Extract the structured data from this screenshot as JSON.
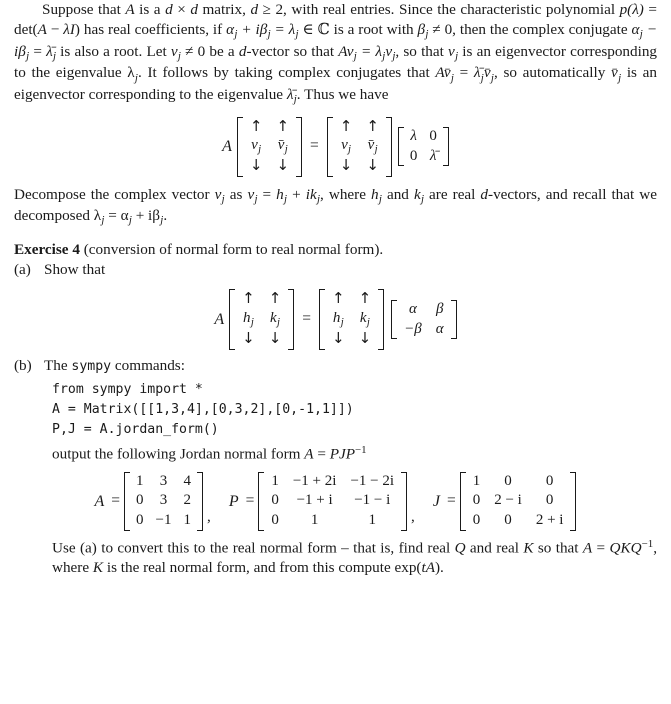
{
  "document": {
    "paragraph1": {
      "s1": "Suppose that ",
      "A1": "A",
      "s2": " is a ",
      "d1": "d",
      "times": " × ",
      "d2": "d",
      "s3": " matrix, ",
      "d3": "d",
      "s4": " ≥ 2, with real entries. Since the characteristic polynomial ",
      "p": "p",
      "lam_paren": "(λ)",
      "eq1": " = det(",
      "A2": "A",
      "minus": " − ",
      "lamI": "λI",
      "close": ") has real coefficients, if ",
      "alpha_j": "α",
      "j1": "j",
      "plus_ibeta": " + iβ",
      "j2": "j",
      "eq2": " = λ",
      "j3": "j",
      "in_C": " ∈ ℂ is a root with ",
      "beta": "β",
      "j4": "j",
      "neq0": " ≠ 0, then the complex conjugate ",
      "alpha_j2": "α",
      "j5": "j",
      "minus_ibeta": " − iβ",
      "j6": "j",
      "eq3": " = ",
      "lambar": "λ̄",
      "j7": "j",
      "s5": " is also a root. Let ",
      "v": "v",
      "j8": "j",
      "neq02": " ≠ 0 be a ",
      "d4": "d",
      "s6": "-vector so that ",
      "Av": "Av",
      "j9": "j",
      "eq4": " = λ",
      "j10": "j",
      "v2": "v",
      "j11": "j",
      "s7": ", so that ",
      "v3": "v",
      "j12": "j",
      "s8": " is an eigenvector corresponding to the eigenvalue λ",
      "j13": "j",
      "s9": ". It follows by taking complex conjugates that ",
      "Avbar": "Av̄",
      "j14": "j",
      "eq5": " = ",
      "lambar2": "λ̄",
      "j15": "j",
      "vbar2": "v̄",
      "j16": "j",
      "s10": ", so automatically ",
      "vbar3": "v̄",
      "j17": "j",
      "s11": " is an eigenvector corresponding to the eigenvalue ",
      "lambar3": "λ̄",
      "j18": "j",
      "s12": ". Thus we have"
    },
    "equation1": {
      "lhs_label": "A",
      "col_up": "↑",
      "col_down": "↓",
      "m1": [
        [
          "v",
          "v̄"
        ]
      ],
      "m1_sub": [
        "j",
        "j"
      ],
      "equals": "=",
      "m2": [
        [
          "v",
          "v̄"
        ]
      ],
      "m2_sub": [
        "j",
        "j"
      ],
      "diag": [
        [
          "λ",
          "0"
        ],
        [
          "0",
          "λ̄"
        ]
      ]
    },
    "paragraph2": {
      "t1": "Decompose the complex vector ",
      "v": "v",
      "j1": "j",
      "t2": " as ",
      "v2": "v",
      "j2": "j",
      "t3": " = ",
      "h": "h",
      "j3": "j",
      "t4": " + ",
      "ik": "ik",
      "j4": "j",
      "t5": ", where ",
      "h2": "h",
      "j5": "j",
      "t6": " and ",
      "k2": "k",
      "j6": "j",
      "t7": " are real ",
      "d": "d",
      "t8": "-vectors, and recall that we decomposed λ",
      "j7": "j",
      "t9": " = α",
      "j8": "j",
      "t10": " + iβ",
      "j9": "j",
      "t11": "."
    },
    "exercise": {
      "header_bold": "Exercise 4",
      "header_rest": " (conversion of normal form to real normal form)."
    },
    "part_a": {
      "label": "(a)",
      "text": "Show that",
      "equation": {
        "lhs_label": "A",
        "col_up": "↑",
        "col_down": "↓",
        "m1": [
          [
            "h",
            "k"
          ]
        ],
        "m1_sub": [
          "j",
          "j"
        ],
        "equals": "=",
        "m2": [
          [
            "h",
            "k"
          ]
        ],
        "m2_sub": [
          "j",
          "j"
        ],
        "rot": [
          [
            "α",
            "β"
          ],
          [
            "−β",
            "α"
          ]
        ]
      }
    },
    "part_b": {
      "label": "(b)",
      "text_before": "The ",
      "mono_word": "sympy",
      "text_after": " commands:",
      "code": "from sympy import *\nA = Matrix([[1,3,4],[0,3,2],[0,-1,1]])\nP,J = A.jordan_form()",
      "output_line": {
        "t1": "output the following Jordan normal form ",
        "A": "A",
        "eq": " = ",
        "PJP": "PJP",
        "sup": "−1"
      },
      "matrices": {
        "A": {
          "name": "A",
          "equals": "=",
          "rows": [
            [
              "1",
              "3",
              "4"
            ],
            [
              "0",
              "3",
              "2"
            ],
            [
              "0",
              "−1",
              "1"
            ]
          ]
        },
        "comma1": ",",
        "P": {
          "name": "P",
          "equals": "=",
          "rows": [
            [
              "1",
              "−1 + 2i",
              "−1 − 2i"
            ],
            [
              "0",
              "−1 + i",
              "−1 − i"
            ],
            [
              "0",
              "1",
              "1"
            ]
          ]
        },
        "comma2": ",",
        "J": {
          "name": "J",
          "equals": "=",
          "rows": [
            [
              "1",
              "0",
              "0"
            ],
            [
              "0",
              "2 − i",
              "0"
            ],
            [
              "0",
              "0",
              "2 + i"
            ]
          ]
        }
      },
      "closing": {
        "t1": "Use (a) to convert this to the real normal form – that is, find real ",
        "Q": "Q",
        "t2": " and real ",
        "K": "K",
        "t3": " so that ",
        "A": "A",
        "eq": " = ",
        "QKQ": "QKQ",
        "sup": "−1",
        "t4": ", where ",
        "K2": "K",
        "t5": " is the real normal form, and from this compute ",
        "exp": "exp(",
        "tA": "tA",
        "t6": ")."
      }
    }
  }
}
